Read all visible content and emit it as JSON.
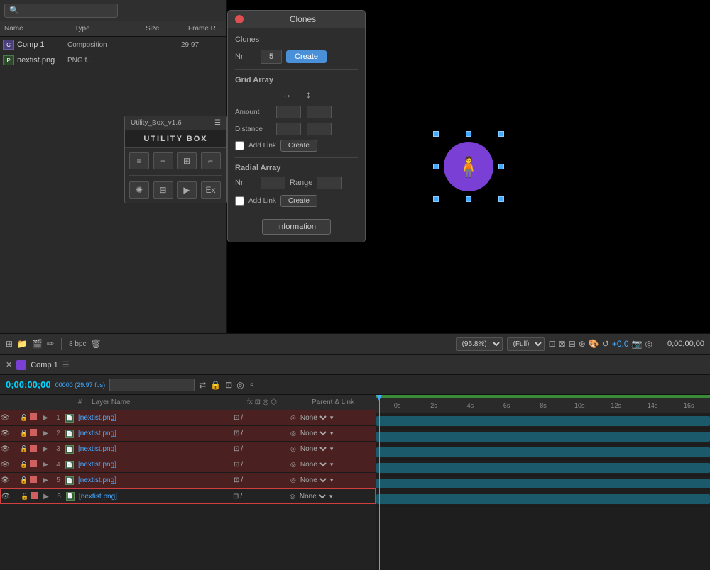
{
  "project": {
    "search_placeholder": "🔍",
    "columns": {
      "name": "Name",
      "type": "Type",
      "size": "Size",
      "frame": "Frame R..."
    },
    "items": [
      {
        "name": "Comp 1",
        "type": "Composition",
        "size": "",
        "frame": "29.97",
        "icon": "comp"
      },
      {
        "name": "nextist.png",
        "type": "PNG f...",
        "size": "",
        "frame": "",
        "icon": "png"
      }
    ]
  },
  "utility_box": {
    "header": "Utility_Box_v1.6",
    "title": "UTILITY BOX",
    "buttons_row1": [
      "≡",
      "+",
      "⊞",
      "⌐"
    ],
    "buttons_row2": [
      "✺",
      "⊞",
      "▶",
      "Ex"
    ]
  },
  "clones_dialog": {
    "title": "Clones",
    "clones_section": {
      "label": "Clones",
      "nr_label": "Nr",
      "nr_value": "5",
      "create_btn": "Create"
    },
    "grid_array": {
      "title": "Grid Array",
      "amount_label": "Amount",
      "distance_label": "Distance",
      "add_link_label": "Add Link",
      "create_btn": "Create"
    },
    "radial_array": {
      "title": "Radial Array",
      "nr_label": "Nr",
      "range_label": "Range",
      "add_link_label": "Add Link",
      "create_btn": "Create"
    },
    "info_btn": "Information"
  },
  "preview": {
    "zoom": "(95.8%)",
    "quality": "(Full)"
  },
  "bottom_toolbar": {
    "bpc": "8 bpc"
  },
  "comp_header": {
    "name": "Comp 1"
  },
  "timeline": {
    "timecode": "0;00;00;00",
    "fps": "00000 (29.97 fps)",
    "time_display": "0;00;00;00",
    "time_markers": [
      "0s",
      "2s",
      "4s",
      "6s",
      "8s",
      "10s",
      "12s",
      "14s",
      "16s"
    ],
    "layer_columns": {
      "num": "#",
      "name": "Layer Name",
      "parent": "Parent & Link"
    },
    "layers": [
      {
        "num": 1,
        "name": "[nextist.png]",
        "selected": true,
        "parent": "None"
      },
      {
        "num": 2,
        "name": "[nextist.png]",
        "selected": true,
        "parent": "None"
      },
      {
        "num": 3,
        "name": "[nextist.png]",
        "selected": true,
        "parent": "None"
      },
      {
        "num": 4,
        "name": "[nextist.png]",
        "selected": true,
        "parent": "None"
      },
      {
        "num": 5,
        "name": "[nextist.png]",
        "selected": true,
        "parent": "None"
      },
      {
        "num": 6,
        "name": "[nextist.png]",
        "selected": false,
        "parent": "None"
      }
    ]
  }
}
